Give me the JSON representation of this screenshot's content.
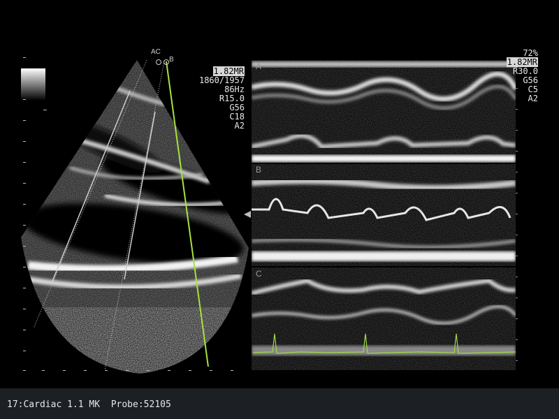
{
  "status_bar": {
    "text": "17:Cardiac 1.1 MK  Probe:52105"
  },
  "params_left": {
    "mode": "1.82MR",
    "frame": "1860/1957",
    "rate": "86Hz",
    "range": "R15.0",
    "gain": "G56",
    "compress": "C18",
    "acoustic": "A2"
  },
  "params_right": {
    "power": "72%",
    "mode": "1.82MR",
    "range": "R30.0",
    "gain": "G56",
    "compress": "C5",
    "acoustic": "A2"
  },
  "mmode_panels": [
    {
      "letter": "A"
    },
    {
      "letter": "B"
    },
    {
      "letter": "C"
    }
  ],
  "cursor_markers": {
    "ac": "AC",
    "b": "B"
  },
  "colors": {
    "ecg": "#9fd94a",
    "cursor_c": "#a9e23c",
    "cursor_ab": "#cfcfcf",
    "background": "#000000",
    "status_bar": "#1c1f24"
  }
}
